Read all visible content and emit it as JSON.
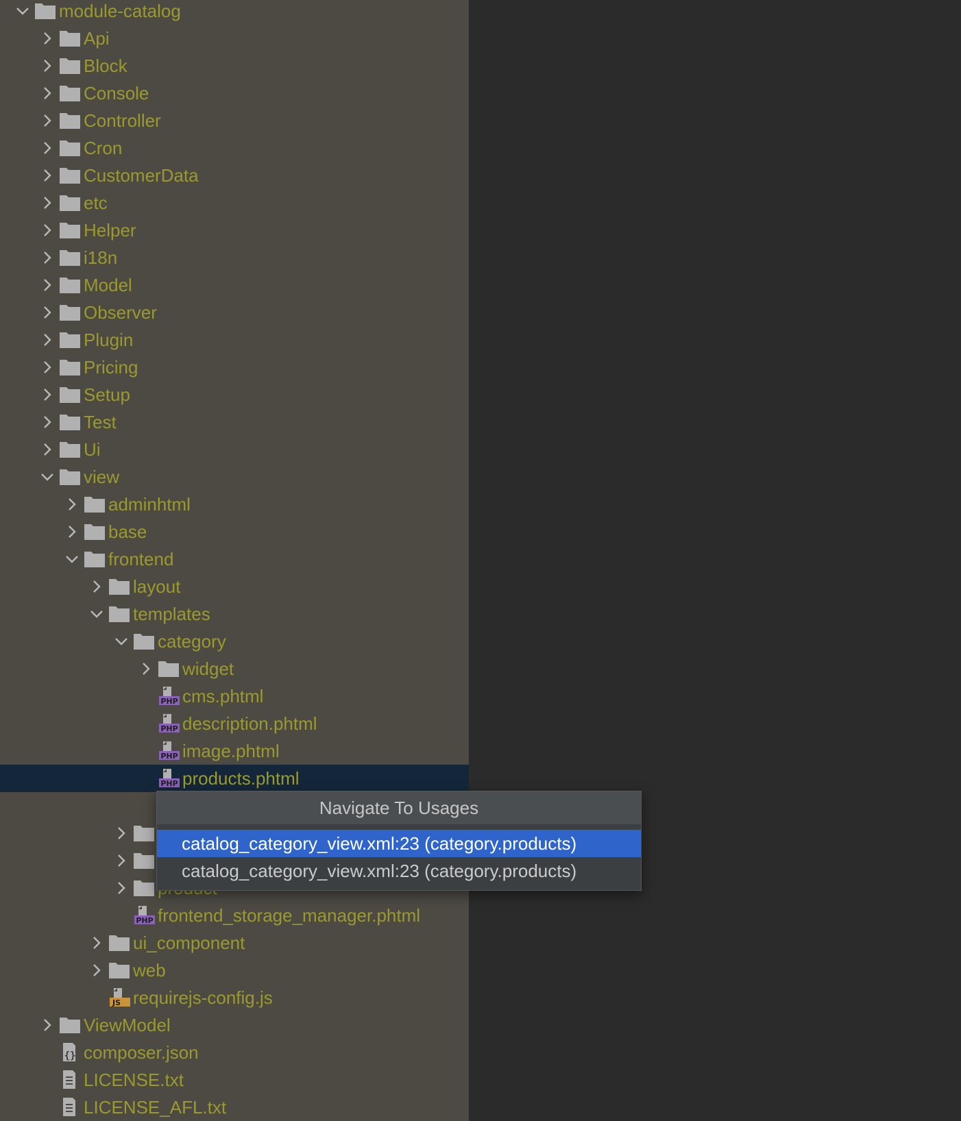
{
  "project_tree": {
    "items": [
      {
        "label": "module-catalog",
        "type": "folder",
        "expanded": true,
        "depth": 0
      },
      {
        "label": "Api",
        "type": "folder",
        "expanded": false,
        "depth": 1
      },
      {
        "label": "Block",
        "type": "folder",
        "expanded": false,
        "depth": 1
      },
      {
        "label": "Console",
        "type": "folder",
        "expanded": false,
        "depth": 1
      },
      {
        "label": "Controller",
        "type": "folder",
        "expanded": false,
        "depth": 1
      },
      {
        "label": "Cron",
        "type": "folder",
        "expanded": false,
        "depth": 1
      },
      {
        "label": "CustomerData",
        "type": "folder",
        "expanded": false,
        "depth": 1
      },
      {
        "label": "etc",
        "type": "folder",
        "expanded": false,
        "depth": 1
      },
      {
        "label": "Helper",
        "type": "folder",
        "expanded": false,
        "depth": 1
      },
      {
        "label": "i18n",
        "type": "folder",
        "expanded": false,
        "depth": 1
      },
      {
        "label": "Model",
        "type": "folder",
        "expanded": false,
        "depth": 1
      },
      {
        "label": "Observer",
        "type": "folder",
        "expanded": false,
        "depth": 1
      },
      {
        "label": "Plugin",
        "type": "folder",
        "expanded": false,
        "depth": 1
      },
      {
        "label": "Pricing",
        "type": "folder",
        "expanded": false,
        "depth": 1
      },
      {
        "label": "Setup",
        "type": "folder",
        "expanded": false,
        "depth": 1
      },
      {
        "label": "Test",
        "type": "folder",
        "expanded": false,
        "depth": 1
      },
      {
        "label": "Ui",
        "type": "folder",
        "expanded": false,
        "depth": 1
      },
      {
        "label": "view",
        "type": "folder",
        "expanded": true,
        "depth": 1
      },
      {
        "label": "adminhtml",
        "type": "folder",
        "expanded": false,
        "depth": 2
      },
      {
        "label": "base",
        "type": "folder",
        "expanded": false,
        "depth": 2
      },
      {
        "label": "frontend",
        "type": "folder",
        "expanded": true,
        "depth": 2
      },
      {
        "label": "layout",
        "type": "folder",
        "expanded": false,
        "depth": 3
      },
      {
        "label": "templates",
        "type": "folder",
        "expanded": true,
        "depth": 3
      },
      {
        "label": "category",
        "type": "folder",
        "expanded": true,
        "depth": 4
      },
      {
        "label": "widget",
        "type": "folder",
        "expanded": false,
        "depth": 5
      },
      {
        "label": "cms.phtml",
        "type": "php",
        "depth": 5
      },
      {
        "label": "description.phtml",
        "type": "php",
        "depth": 5
      },
      {
        "label": "image.phtml",
        "type": "php",
        "depth": 5
      },
      {
        "label": "products.phtml",
        "type": "php",
        "depth": 5,
        "selected": true
      },
      {
        "label": "",
        "type": "gap",
        "depth": 5
      },
      {
        "label": "",
        "type": "folder",
        "expanded": false,
        "depth": 4
      },
      {
        "label": "",
        "type": "folder",
        "expanded": false,
        "depth": 4
      },
      {
        "label": "product",
        "type": "folder",
        "expanded": false,
        "depth": 4,
        "partially_hidden": true
      },
      {
        "label": "frontend_storage_manager.phtml",
        "type": "php",
        "depth": 4
      },
      {
        "label": "ui_component",
        "type": "folder",
        "expanded": false,
        "depth": 3
      },
      {
        "label": "web",
        "type": "folder",
        "expanded": false,
        "depth": 3
      },
      {
        "label": "requirejs-config.js",
        "type": "js",
        "depth": 3
      },
      {
        "label": "ViewModel",
        "type": "folder",
        "expanded": false,
        "depth": 1
      },
      {
        "label": "composer.json",
        "type": "json",
        "depth": 1
      },
      {
        "label": "LICENSE.txt",
        "type": "txt",
        "depth": 1
      },
      {
        "label": "LICENSE_AFL.txt",
        "type": "txt",
        "depth": 1
      }
    ]
  },
  "popup": {
    "title": "Navigate To Usages",
    "items": [
      {
        "label": "catalog_category_view.xml:23 (category.products)",
        "active": true
      },
      {
        "label": "catalog_category_view.xml:23 (category.products)",
        "active": false
      }
    ]
  },
  "colors": {
    "tree_bg": "#4d4a44",
    "label": "#9a9a2e",
    "selected_row": "#14273a",
    "popup_active": "#2f65ca",
    "editor_bg": "#2b2b2b"
  },
  "icons": {
    "folder": "folder-icon",
    "php": "php-file-icon",
    "js": "js-file-icon",
    "json": "json-file-icon",
    "txt": "text-file-icon",
    "expanded": "chevron-down-icon",
    "collapsed": "chevron-right-icon"
  }
}
